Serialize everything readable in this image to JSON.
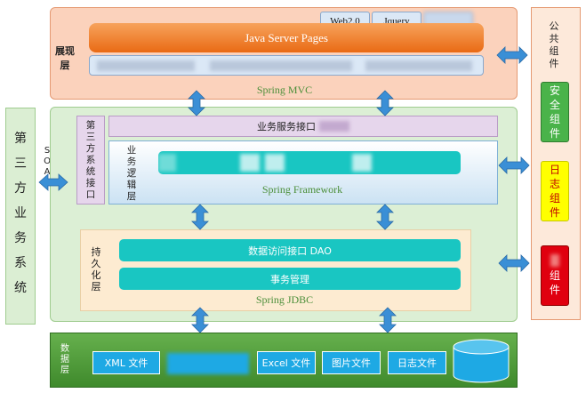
{
  "presentation_layer": {
    "label": "展现层",
    "tags": [
      "Web2.0",
      "Jquery"
    ],
    "jsp": "Java Server Pages",
    "framework": "Spring MVC"
  },
  "third_party": {
    "label": "第三方业务系统",
    "soa": "SOA",
    "interface_label": "第三方系统接口"
  },
  "business_layer": {
    "service_interface": "业务服务接口",
    "logic_label": "业务逻辑层",
    "framework": "Spring Framework"
  },
  "persistence_layer": {
    "label": "持久化层",
    "dao": "数据访问接口 DAO",
    "transaction": "事务管理",
    "framework": "Spring JDBC"
  },
  "data_layer": {
    "label": "数据层",
    "items": [
      "XML 文件",
      "Excel 文件",
      "图片文件",
      "日志文件"
    ]
  },
  "public_components": {
    "label": "公共组件",
    "security": "安全组件",
    "log": "日志组件",
    "other": "组件"
  }
}
